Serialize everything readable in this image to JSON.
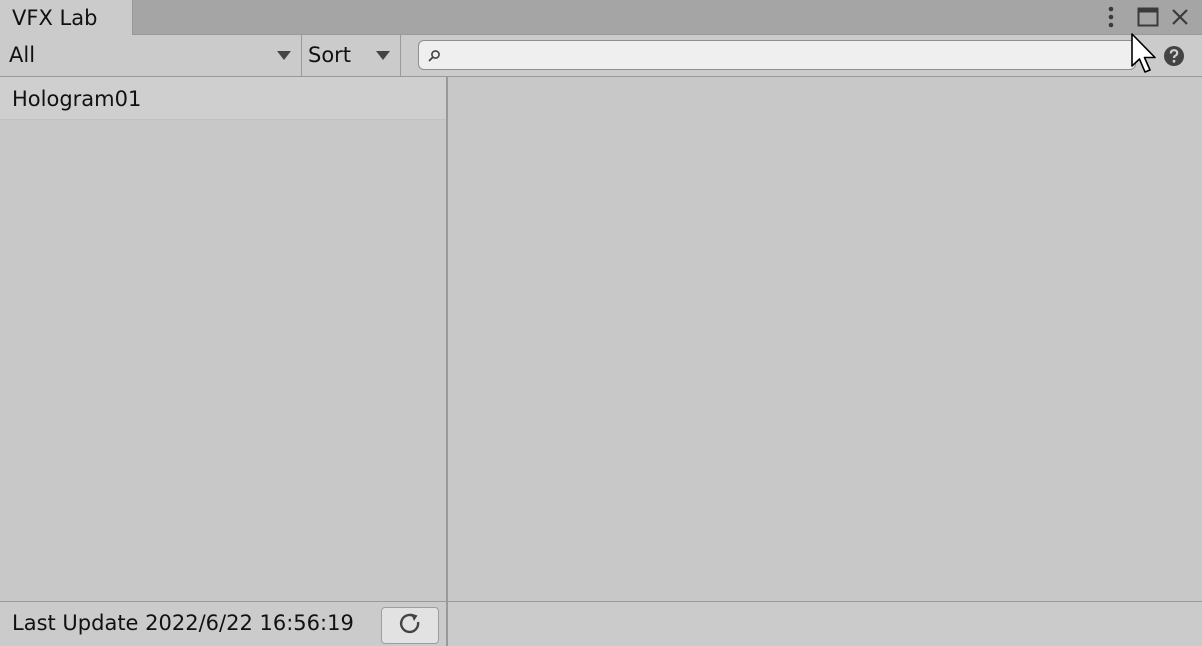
{
  "window": {
    "tab_title": "VFX Lab",
    "menu_icon": "kebab-menu-icon",
    "maximize_icon": "maximize-icon",
    "close_icon": "close-icon"
  },
  "toolbar": {
    "filter_value": "All",
    "sort_label": "Sort",
    "search": {
      "value": "",
      "placeholder": ""
    },
    "help_icon": "help-icon"
  },
  "list": {
    "items": [
      {
        "label": "Hologram01"
      }
    ]
  },
  "footer": {
    "last_update": "Last Update 2022/6/22 16:56:19",
    "refresh_icon": "refresh-icon"
  }
}
